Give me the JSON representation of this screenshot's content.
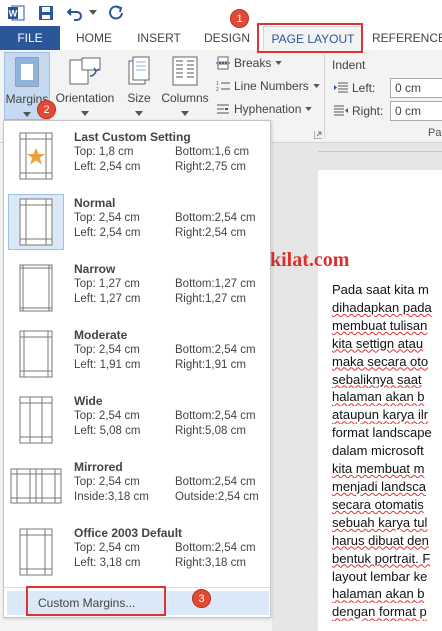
{
  "qat": {
    "icons": [
      "word-app-icon",
      "save-icon",
      "undo-icon",
      "undo-dropdown-icon",
      "redo-icon"
    ]
  },
  "tabs": {
    "file": "FILE",
    "home": "HOME",
    "insert": "INSERT",
    "design": "DESIGN",
    "page_layout": "PAGE LAYOUT",
    "references": "REFERENCES"
  },
  "ribbon": {
    "margins": "Margins",
    "orientation": "Orientation",
    "size": "Size",
    "columns": "Columns",
    "breaks": "Breaks",
    "line_numbers": "Line Numbers",
    "hyphenation": "Hyphenation",
    "indent_label": "Indent",
    "left_label": "Left:",
    "left_value": "0 cm",
    "right_label": "Right:",
    "right_value": "0 cm",
    "group_partial": "Pa"
  },
  "badges": {
    "b1": "1",
    "b2": "2",
    "b3": "3"
  },
  "watermark": "www.carakilat.com",
  "margins_menu": {
    "options": [
      {
        "name": "Last Custom Setting",
        "top": "Top:    1,8 cm",
        "bottom": "Bottom:1,6 cm",
        "left": "Left:   2,54 cm",
        "right": "Right:2,75 cm"
      },
      {
        "name": "Normal",
        "top": "Top:    2,54 cm",
        "bottom": "Bottom:2,54 cm",
        "left": "Left:    2,54 cm",
        "right": "Right:2,54 cm"
      },
      {
        "name": "Narrow",
        "top": "Top:    1,27 cm",
        "bottom": "Bottom:1,27 cm",
        "left": "Left:    1,27 cm",
        "right": "Right:1,27 cm"
      },
      {
        "name": "Moderate",
        "top": "Top:    2,54 cm",
        "bottom": "Bottom:2,54 cm",
        "left": "Left:    1,91 cm",
        "right": "Right:1,91 cm"
      },
      {
        "name": "Wide",
        "top": "Top:    2,54 cm",
        "bottom": "Bottom:2,54 cm",
        "left": "Left:    5,08 cm",
        "right": "Right:5,08 cm"
      },
      {
        "name": "Mirrored",
        "top": "Top:    2,54 cm",
        "bottom": "Bottom:2,54 cm",
        "left": "Inside:3,18 cm",
        "right": "Outside:2,54 cm"
      },
      {
        "name": "Office 2003 Default",
        "top": "Top:    2,54 cm",
        "bottom": "Bottom:2,54 cm",
        "left": "Left:    3,18 cm",
        "right": "Right:3,18 cm"
      }
    ],
    "custom_margins": "Custom Margins..."
  },
  "document": {
    "lines": [
      "Pada saat kita m",
      "dihadapkan pada",
      "membuat tulisan",
      "kita settign atau",
      "maka secara oto",
      "sebaliknya saat",
      "halaman akan b",
      "ataupun karya ilr",
      "format landscape",
      "dalam microsoft",
      "kita membuat m",
      "menjadi landsca",
      "secara otomatis",
      "sebuah karya tul",
      "harus dibuat den",
      "bentuk portrait. F",
      "layout lembar ke",
      "halaman akan b",
      "dengan format p"
    ]
  },
  "colors": {
    "file_tab": "#2b579a",
    "accent_red": "#e03232",
    "selection": "#c5daf2"
  }
}
